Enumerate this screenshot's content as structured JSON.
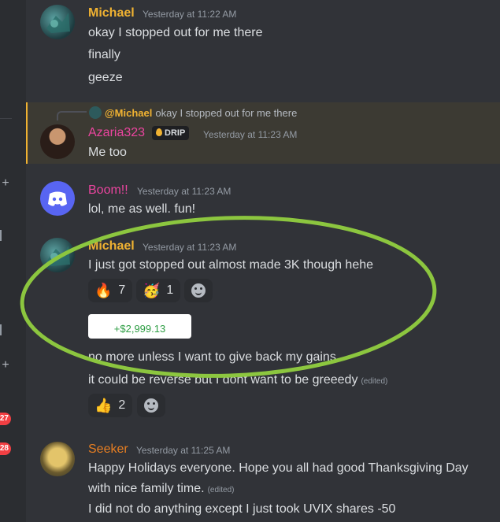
{
  "messages": [
    {
      "author": "Michael",
      "time": "Yesterday at 11:22 AM",
      "color": "#f0b232",
      "lines": [
        "okay I stopped out for me there",
        "finally",
        "geeze"
      ]
    },
    {
      "reply": {
        "mention": "@Michael",
        "text": "okay I stopped out for me there"
      },
      "author": "Azaria323",
      "role": "DRIP",
      "time": "Yesterday at 11:23 AM",
      "color": "#eb459f",
      "lines": [
        "Me too"
      ]
    },
    {
      "author": "Boom!!",
      "time": "Yesterday at 11:23 AM",
      "color": "#eb459f",
      "lines": [
        "lol, me as well. fun!"
      ]
    },
    {
      "author": "Michael",
      "time": "Yesterday at 11:23 AM",
      "color": "#f0b232",
      "lines": [
        "I just got stopped out almost made 3K though hehe"
      ],
      "reactions": [
        {
          "emoji": "🔥",
          "count": "7"
        },
        {
          "emoji": "🥳",
          "count": "1"
        }
      ],
      "pnl": "+$2,999.13",
      "more_lines": [
        "no more unless I want to give back my gains",
        "it could be reverse but I dont want to be greeedy"
      ],
      "edited": "(edited)",
      "reactions2": [
        {
          "emoji": "👍",
          "count": "2"
        }
      ]
    },
    {
      "author": "Seeker",
      "time": "Yesterday at 11:25 AM",
      "color": "#e67e22",
      "lines": [
        "Happy Holidays everyone. Hope you all had good Thanksgiving Day",
        "with nice family time.",
        "I did not do anything except I just took UVIX shares -50"
      ],
      "edited": "(edited)"
    }
  ],
  "rail": {
    "badge1": "27",
    "badge2": "28"
  },
  "highlight_color": "#8cc63f"
}
